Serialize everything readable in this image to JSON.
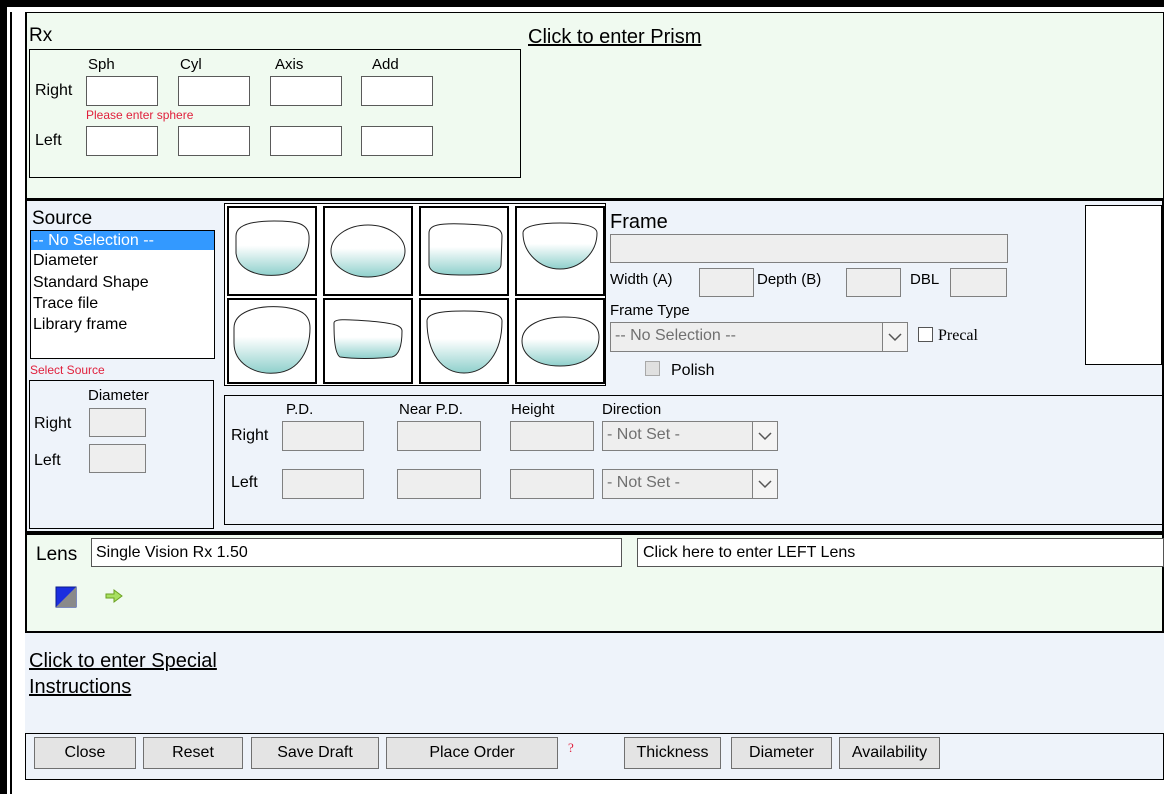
{
  "rx": {
    "title": "Rx",
    "headers": {
      "sph": "Sph",
      "cyl": "Cyl",
      "axis": "Axis",
      "add": "Add"
    },
    "right_label": "Right",
    "left_label": "Left",
    "error": "Please enter sphere",
    "prism_link": "Click to enter Prism"
  },
  "source": {
    "title": "Source",
    "options": [
      "-- No Selection --",
      "Diameter",
      "Standard Shape",
      "Trace file",
      "Library frame"
    ],
    "selected": "-- No Selection --",
    "error": "Select Source",
    "diameter_header": "Diameter",
    "right_label": "Right",
    "left_label": "Left"
  },
  "frame": {
    "title": "Frame",
    "width_label": "Width (A)",
    "depth_label": "Depth (B)",
    "dbl_label": "DBL",
    "type_label": "Frame Type",
    "type_value": "-- No Selection --",
    "precal_label": "Precal",
    "polish_label": "Polish"
  },
  "measure": {
    "headers": {
      "pd": "P.D.",
      "near_pd": "Near P.D.",
      "height": "Height",
      "direction": "Direction"
    },
    "right_label": "Right",
    "left_label": "Left",
    "right_direction": "- Not Set -",
    "left_direction": "- Not Set -"
  },
  "lens": {
    "label": "Lens",
    "right_value": "Single Vision Rx 1.50",
    "left_link": "Click here to enter LEFT Lens"
  },
  "special": {
    "line1": "Click to enter Special",
    "line2": "Instructions"
  },
  "buttons": {
    "close": "Close",
    "reset": "Reset",
    "save_draft": "Save Draft",
    "place_order": "Place Order",
    "help": "?",
    "thickness": "Thickness",
    "diameter": "Diameter",
    "availability": "Availability"
  },
  "colors": {
    "error": "#e0203c",
    "selection": "#3399ff",
    "green_panel": "#f0faf0",
    "blue_panel": "#eef3fa"
  }
}
